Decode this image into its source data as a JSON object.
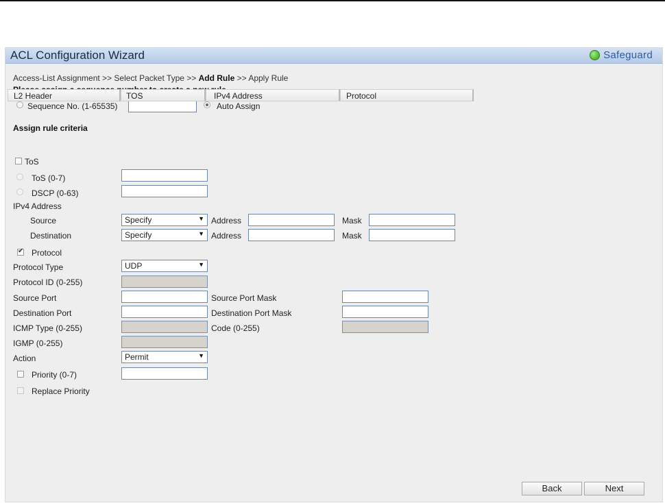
{
  "window": {
    "title": "ACL Configuration Wizard",
    "safeguard_label": "Safeguard",
    "safeguard_color": "#3fb424"
  },
  "breadcrumb": {
    "step1": "Access-List Assignment",
    "sep": " >> ",
    "step2": "Select Packet Type",
    "step3": "Add Rule",
    "step4": "Apply Rule"
  },
  "sequence": {
    "instruction": "Please assign a sequence number to create a new rule.",
    "seq_label": "Sequence No. (1-65535)",
    "seq_value": "",
    "auto_label": "Auto Assign"
  },
  "criteria": {
    "heading": "Assign rule criteria",
    "tabs": [
      "L2 Header",
      "TOS",
      "IPv4 Address",
      "Protocol"
    ]
  },
  "tos": {
    "check_label": "ToS",
    "tos_label": "ToS  (0-7)",
    "dscp_label": "DSCP  (0-63)",
    "tos_value": "",
    "dscp_value": ""
  },
  "ipv4": {
    "heading": "IPv4 Address",
    "source_label": "Source",
    "destination_label": "Destination",
    "source_select": "Specify",
    "destination_select": "Specify",
    "address_label": "Address",
    "mask_label": "Mask"
  },
  "protocol": {
    "check_label": "Protocol",
    "type_label": "Protocol Type",
    "type_value": "UDP",
    "id_label": "Protocol ID (0-255)",
    "source_port_label": "Source Port",
    "source_port_mask_label": "Source Port Mask",
    "dest_port_label": "Destination Port",
    "dest_port_mask_label": "Destination Port Mask",
    "icmp_type_label": "ICMP Type (0-255)",
    "code_label": "Code (0-255)",
    "igmp_label": "IGMP (0-255)"
  },
  "action": {
    "label": "Action",
    "value": "Permit",
    "priority_label": "Priority  (0-7)",
    "replace_priority_label": "Replace Priority"
  },
  "buttons": {
    "back": "Back",
    "next": "Next"
  }
}
